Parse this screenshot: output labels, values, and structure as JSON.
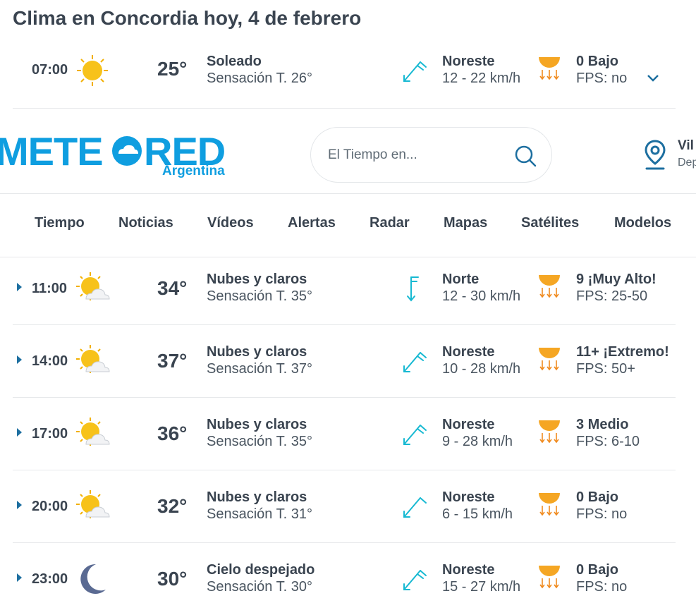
{
  "title": "Clima en Concordia hoy, 4 de febrero",
  "header": {
    "logo_text": "METEORED",
    "logo_sub": "Argentina",
    "search_placeholder": "El Tiempo en...",
    "location_name": "Vil",
    "location_sub": "Dep"
  },
  "nav": [
    "Tiempo",
    "Noticias",
    "Vídeos",
    "Alertas",
    "Radar",
    "Mapas",
    "Satélites",
    "Modelos"
  ],
  "first_row": {
    "time": "07:00",
    "icon": "sun-icon",
    "temp": "25°",
    "condition": "Soleado",
    "feel": "Sensación T. 26°",
    "wind_dir": "Noreste",
    "wind_speed": "12 - 22 km/h",
    "uv": "0 Bajo",
    "fps": "FPS: no"
  },
  "rows": [
    {
      "time": "11:00",
      "icon": "sun-cloud-icon",
      "temp": "34°",
      "condition": "Nubes y claros",
      "feel": "Sensación T. 35°",
      "wind_dir": "Norte",
      "wind_speed": "12 - 30 km/h",
      "uv": "9 ¡Muy Alto!",
      "fps": "FPS: 25-50"
    },
    {
      "time": "14:00",
      "icon": "sun-cloud-icon",
      "temp": "37°",
      "condition": "Nubes y claros",
      "feel": "Sensación T. 37°",
      "wind_dir": "Noreste",
      "wind_speed": "10 - 28 km/h",
      "uv": "11+ ¡Extremo!",
      "fps": "FPS: 50+"
    },
    {
      "time": "17:00",
      "icon": "sun-cloud-icon",
      "temp": "36°",
      "condition": "Nubes y claros",
      "feel": "Sensación T. 35°",
      "wind_dir": "Noreste",
      "wind_speed": "9 - 28 km/h",
      "uv": "3 Medio",
      "fps": "FPS: 6-10"
    },
    {
      "time": "20:00",
      "icon": "sun-cloud-icon",
      "temp": "32°",
      "condition": "Nubes y claros",
      "feel": "Sensación T. 31°",
      "wind_dir": "Noreste",
      "wind_speed": "6 - 15 km/h",
      "uv": "0 Bajo",
      "fps": "FPS: no"
    },
    {
      "time": "23:00",
      "icon": "moon-icon",
      "temp": "30°",
      "condition": "Cielo despejado",
      "feel": "Sensación T. 30°",
      "wind_dir": "Noreste",
      "wind_speed": "15 - 27 km/h",
      "uv": "0 Bajo",
      "fps": "FPS: no"
    }
  ],
  "colors": {
    "text": "#3a4450",
    "brand": "#0f9ee0",
    "wind": "#17b9d2",
    "sun": "#f5b400",
    "uv_arrow": "#f08a1e"
  }
}
